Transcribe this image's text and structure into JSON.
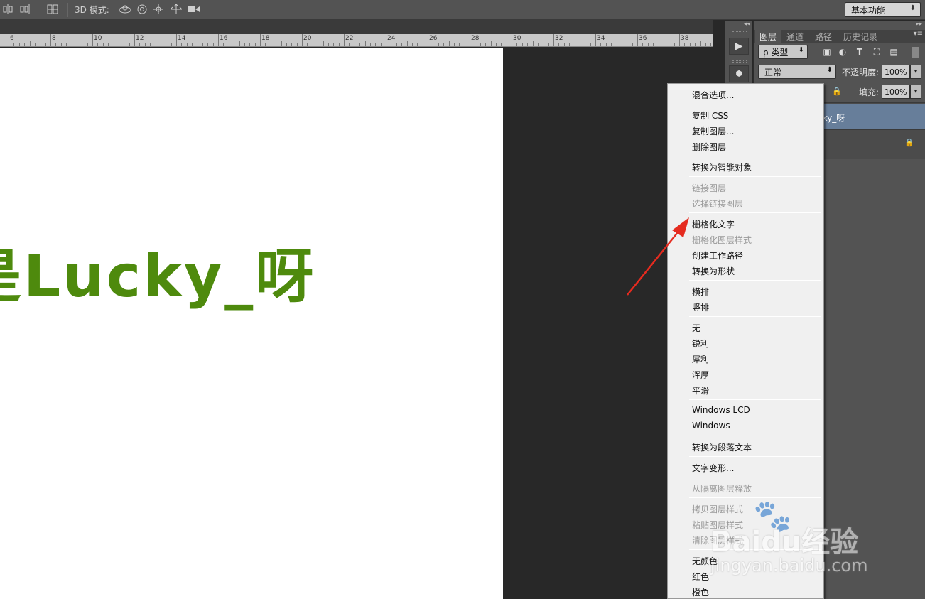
{
  "options_bar": {
    "mode_3d_label": "3D 模式:",
    "workspace_label": "基本功能"
  },
  "ruler": {
    "labels": [
      "6",
      "8",
      "10",
      "12",
      "14",
      "16",
      "18",
      "20",
      "22",
      "24",
      "26",
      "28",
      "30",
      "32",
      "34",
      "36",
      "38"
    ]
  },
  "canvas": {
    "text": "是Lucky_呀",
    "text_color": "#4e8a0d"
  },
  "layers_panel": {
    "tabs": [
      "图层",
      "通道",
      "路径",
      "历史记录"
    ],
    "active_tab": "图层",
    "filter_label": "ρ 类型",
    "blend_mode": "正常",
    "opacity_label": "不透明度:",
    "opacity_value": "100%",
    "fill_label": "填充:",
    "fill_value": "100%",
    "layers": [
      {
        "name": "cky_呀",
        "selected": true
      },
      {
        "name": "",
        "selected": false,
        "locked": true
      }
    ]
  },
  "context_menu": {
    "items": [
      {
        "label": "混合选项...",
        "enabled": true
      },
      {
        "label": "复制 CSS",
        "enabled": true
      },
      {
        "label": "复制图层...",
        "enabled": true
      },
      {
        "label": "删除图层",
        "enabled": true
      },
      {
        "label": "转换为智能对象",
        "enabled": true
      },
      {
        "label": "链接图层",
        "enabled": false
      },
      {
        "label": "选择链接图层",
        "enabled": false
      },
      {
        "label": "栅格化文字",
        "enabled": true,
        "highlighted_by_arrow": true
      },
      {
        "label": "栅格化图层样式",
        "enabled": false
      },
      {
        "label": "创建工作路径",
        "enabled": true
      },
      {
        "label": "转换为形状",
        "enabled": true
      },
      {
        "label": "横排",
        "enabled": true
      },
      {
        "label": "竖排",
        "enabled": true
      },
      {
        "label": "无",
        "enabled": true
      },
      {
        "label": "锐利",
        "enabled": true
      },
      {
        "label": "犀利",
        "enabled": true
      },
      {
        "label": "浑厚",
        "enabled": true
      },
      {
        "label": "平滑",
        "enabled": true
      },
      {
        "label": "Windows LCD",
        "enabled": true
      },
      {
        "label": "Windows",
        "enabled": true
      },
      {
        "label": "转换为段落文本",
        "enabled": true
      },
      {
        "label": "文字变形...",
        "enabled": true
      },
      {
        "label": "从隔离图层释放",
        "enabled": false
      },
      {
        "label": "拷贝图层样式",
        "enabled": false
      },
      {
        "label": "粘贴图层样式",
        "enabled": false
      },
      {
        "label": "清除图层样式",
        "enabled": false
      },
      {
        "label": "无颜色",
        "enabled": true
      },
      {
        "label": "红色",
        "enabled": true
      },
      {
        "label": "橙色",
        "enabled": true
      }
    ],
    "arrow_color": "#e52b1f"
  },
  "watermark": {
    "brand": "Baidu经验",
    "url": "jingyan.baidu.com"
  }
}
